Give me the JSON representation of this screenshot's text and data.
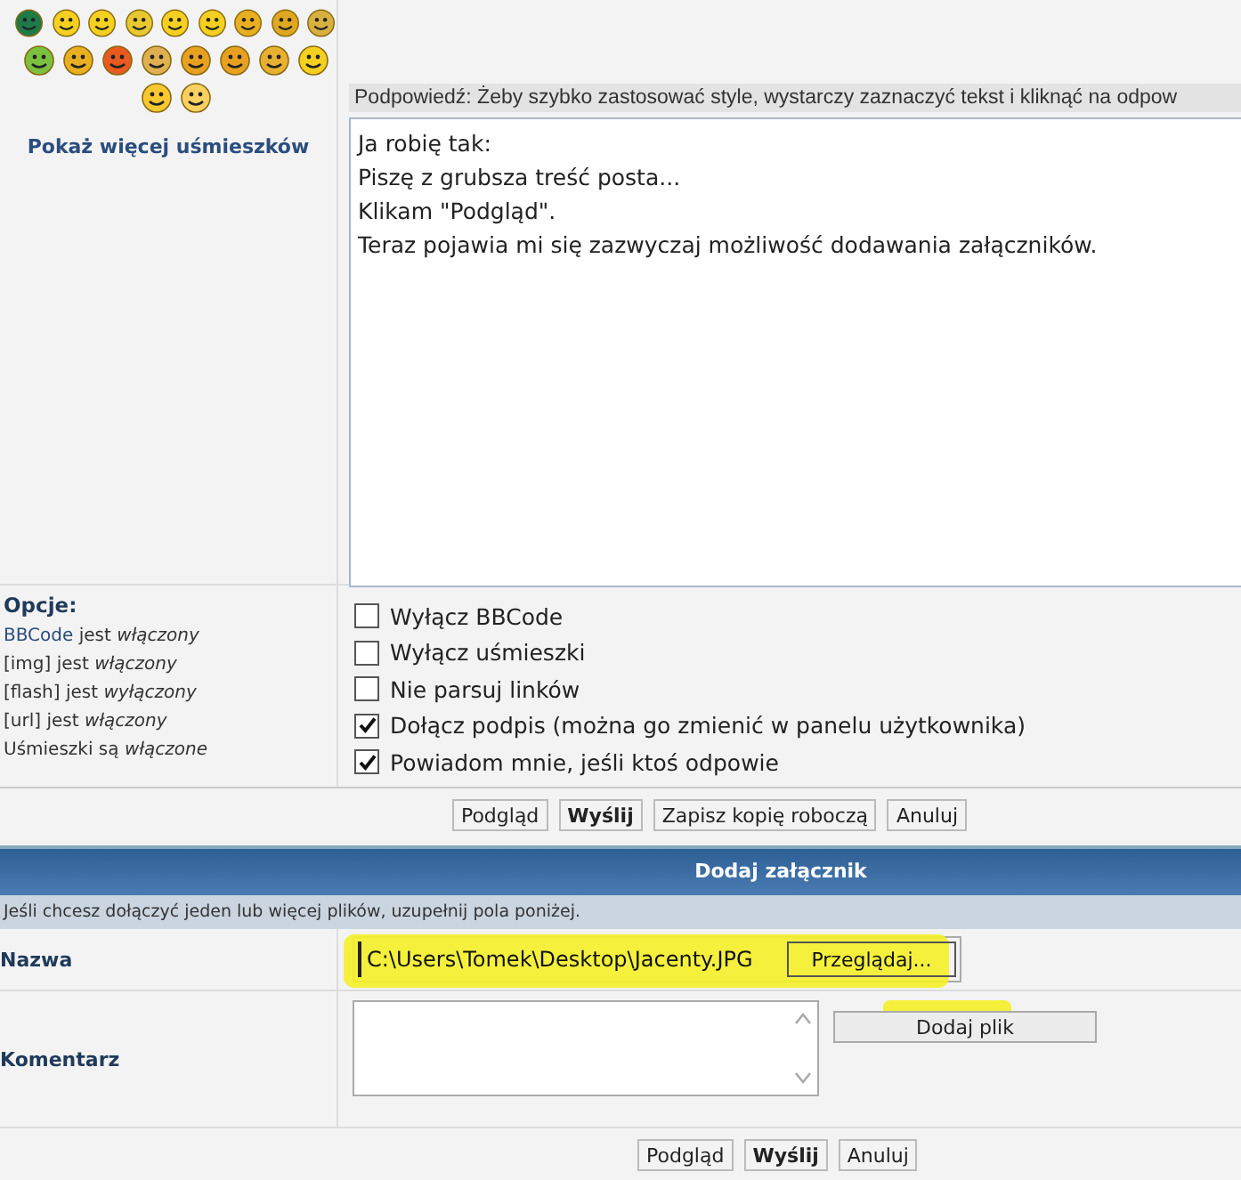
{
  "smileys": [
    {
      "color": "#1f7a4a"
    },
    {
      "color": "#f5d020"
    },
    {
      "color": "#f5d020"
    },
    {
      "color": "#e8c830"
    },
    {
      "color": "#f5d020"
    },
    {
      "color": "#f5d020"
    },
    {
      "color": "#e8b020"
    },
    {
      "color": "#e0a820"
    },
    {
      "color": "#d8b040"
    },
    {
      "color": "#7cc040"
    },
    {
      "color": "#e8b020"
    },
    {
      "color": "#e85a20"
    },
    {
      "color": "#e0b050"
    },
    {
      "color": "#e8a020"
    },
    {
      "color": "#e8a020"
    },
    {
      "color": "#e8b030"
    },
    {
      "color": "#f5d020"
    },
    {
      "color": "#f8c830"
    },
    {
      "color": "#fad060"
    }
  ],
  "more_smileys_link": "Pokaż więcej uśmieszków",
  "hint": "Podpowiedź: Żeby szybko zastosować style, wystarczy zaznaczyć tekst i kliknąć na odpow",
  "message_lines": [
    "Ja robię tak:",
    "Piszę z grubsza treść posta...",
    "Klikam \"Podgląd\".",
    "Teraz pojawia mi się zazwyczaj możliwość dodawania załączników."
  ],
  "options": {
    "title": "Opcje:",
    "status": [
      {
        "kind": "link",
        "link": "BBCode",
        "text": " jest *włączony*"
      },
      {
        "kind": "plain",
        "text": "[img] jest *włączony*"
      },
      {
        "kind": "plain",
        "text": "[flash] jest *wyłączony*"
      },
      {
        "kind": "plain",
        "text": "[url] jest *włączony*"
      },
      {
        "kind": "plain",
        "text": "Uśmieszki są *włączone*"
      }
    ],
    "checkboxes": [
      {
        "label": "Wyłącz BBCode",
        "checked": false
      },
      {
        "label": "Wyłącz uśmieszki",
        "checked": false
      },
      {
        "label": "Nie parsuj linków",
        "checked": false
      },
      {
        "label": "Dołącz podpis (można go zmienić w panelu użytkownika)",
        "checked": true
      },
      {
        "label": "Powiadom mnie, jeśli ktoś odpowie",
        "checked": true
      }
    ]
  },
  "post_buttons": [
    {
      "label": "Podgląd",
      "primary": false
    },
    {
      "label": "Wyślij",
      "primary": true
    },
    {
      "label": "Zapisz kopię roboczą",
      "primary": false
    },
    {
      "label": "Anuluj",
      "primary": false
    }
  ],
  "attachment": {
    "title": "Dodaj załącznik",
    "info": "Jeśli chcesz dołączyć jeden lub więcej plików, uzupełnij pola poniżej.",
    "name_label": "Nazwa",
    "file_value": "C:\\Users\\Tomek\\Desktop\\Jacenty.JPG",
    "browse_button": "Przeglądaj...",
    "comment_label": "Komentarz",
    "add_button": "Dodaj plik"
  },
  "bottom_buttons": [
    {
      "label": "Podgląd",
      "primary": false
    },
    {
      "label": "Wyślij",
      "primary": true
    },
    {
      "label": "Anuluj",
      "primary": false
    }
  ]
}
